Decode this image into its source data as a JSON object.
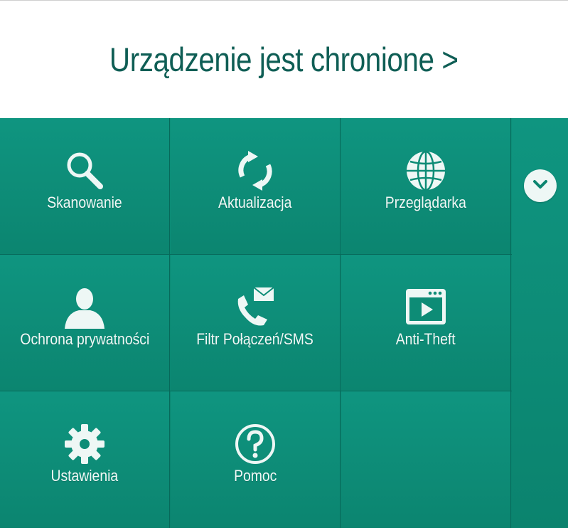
{
  "header": {
    "status_text": "Urządzenie jest chronione >"
  },
  "tiles": [
    {
      "label": "Skanowanie",
      "icon": "magnifier-icon"
    },
    {
      "label": "Aktualizacja",
      "icon": "refresh-icon"
    },
    {
      "label": "Przeglądarka",
      "icon": "globe-icon"
    },
    {
      "label": "Ochrona prywatności",
      "icon": "person-icon"
    },
    {
      "label": "Filtr Połączeń/SMS",
      "icon": "phone-envelope-icon"
    },
    {
      "label": "Anti-Theft",
      "icon": "browser-window-play-icon"
    },
    {
      "label": "Ustawienia",
      "icon": "gear-icon"
    },
    {
      "label": "Pomoc",
      "icon": "question-icon"
    }
  ],
  "side": {
    "expand_icon": "chevron-down-icon"
  },
  "colors": {
    "brand_dark": "#0f5e55",
    "tile_green": "#0c8c76",
    "divider": "#07695a"
  }
}
